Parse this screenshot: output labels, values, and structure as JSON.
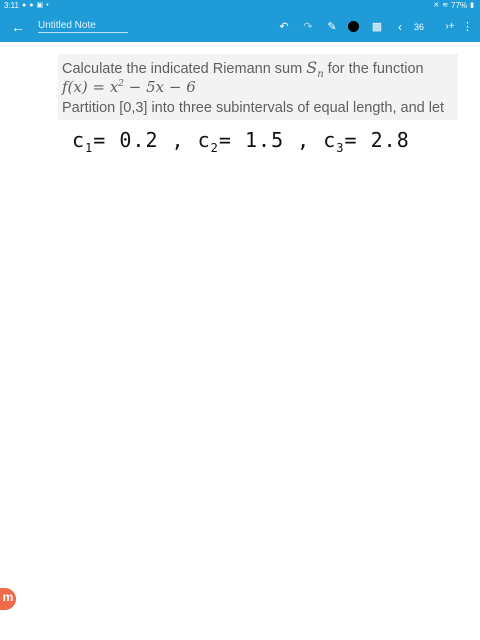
{
  "status_bar": {
    "time": "3:11",
    "battery": "77%",
    "icons": [
      "notification-icon",
      "notification-icon",
      "gallery-icon",
      "more-icon",
      "mute-icon",
      "wifi-icon",
      "battery-icon"
    ]
  },
  "app_bar": {
    "title": "Untitled Note",
    "page_number": "36",
    "color": "#1f9bd7"
  },
  "question": {
    "line1_prefix": "Calculate the indicated Riemann sum",
    "line1_sn": "S",
    "line1_sub": "n",
    "line1_suffix": "for the function",
    "line2_func": "f(x) = x",
    "line2_exp": "2",
    "line2_rest": " − 5x − 6",
    "line3": "Partition [0,3] into three subintervals of equal length, and let"
  },
  "handwriting": {
    "c1_label": "c",
    "c1_sub": "1",
    "c1_value": "= 0.2 ,",
    "c2_label": "c",
    "c2_sub": "2",
    "c2_value": "= 1.5 ,",
    "c3_label": "c",
    "c3_sub": "3",
    "c3_value": "= 2.8"
  },
  "logo_text": "m"
}
